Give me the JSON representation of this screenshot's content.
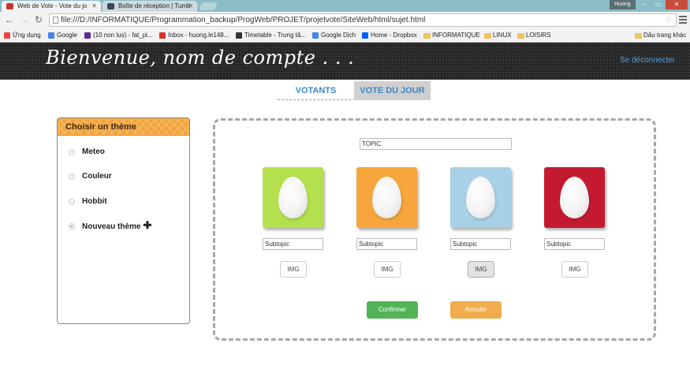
{
  "browser": {
    "tabs": [
      {
        "title": "Web de Vote - Vote du jo",
        "favicon_color": "#c0392b"
      },
      {
        "title": "Boîte de réception | Tumb",
        "favicon_color": "#36465d"
      }
    ],
    "user_badge": "Huong",
    "url": "file:///D:/INFORMATIQUE/Programmation_backup/ProgWeb/PROJET/projetvote/SiteWeb/html/sujet.html",
    "bookmarks": [
      {
        "label": "Ứng dụng",
        "icon": "apps-icon",
        "color": "#e44"
      },
      {
        "label": "Google",
        "icon": "google-icon",
        "color": "#4285f4"
      },
      {
        "label": "(10 non lus) - fat_pi...",
        "icon": "yahoo-mail-icon",
        "color": "#5f2b91"
      },
      {
        "label": "Inbox - huong.le148...",
        "icon": "gmail-icon",
        "color": "#d93025"
      },
      {
        "label": "Timetable - Trung tâ...",
        "icon": "timetable-icon",
        "color": "#333"
      },
      {
        "label": "Google Dịch",
        "icon": "translate-icon",
        "color": "#4285f4"
      },
      {
        "label": "Home - Dropbox",
        "icon": "dropbox-icon",
        "color": "#0061ff"
      },
      {
        "label": "INFORMATIQUE",
        "icon": "folder-icon"
      },
      {
        "label": "LINUX",
        "icon": "folder-icon"
      },
      {
        "label": "LOISIRS",
        "icon": "folder-icon"
      },
      {
        "label": "Dấu trang khác",
        "icon": "folder-icon"
      }
    ]
  },
  "header": {
    "welcome": "Bienvenue, nom de compte . . .",
    "logout": "Se déconnecter"
  },
  "nav": {
    "tabs": [
      {
        "label": "VOTANTS"
      },
      {
        "label": "VOTE DU JOUR"
      }
    ]
  },
  "themes": {
    "heading": "Choisir un thème",
    "items": [
      {
        "label": "Meteo",
        "selected": false
      },
      {
        "label": "Couleur",
        "selected": false
      },
      {
        "label": "Hobbit",
        "selected": false
      },
      {
        "label": "Nouveau thème",
        "selected": true
      }
    ],
    "add_glyph": "✚"
  },
  "vote": {
    "topic_value": "TOPIC",
    "options": [
      {
        "color": "#b4e04e",
        "subtopic": "Subtopic",
        "img_label": "IMG"
      },
      {
        "color": "#f6a63c",
        "subtopic": "Subtopic",
        "img_label": "IMG"
      },
      {
        "color": "#a8d1e6",
        "subtopic": "Subtopic",
        "img_label": "IMG"
      },
      {
        "color": "#c31a31",
        "subtopic": "Subtopic",
        "img_label": "IMG"
      }
    ],
    "confirm_label": "Confirmer",
    "cancel_label": "Annuler"
  },
  "colors": {
    "accent_blue": "#3d8ac6",
    "confirm_green": "#53b457",
    "cancel_orange": "#f0ad4e",
    "theme_header_orange": "#f3a237"
  }
}
